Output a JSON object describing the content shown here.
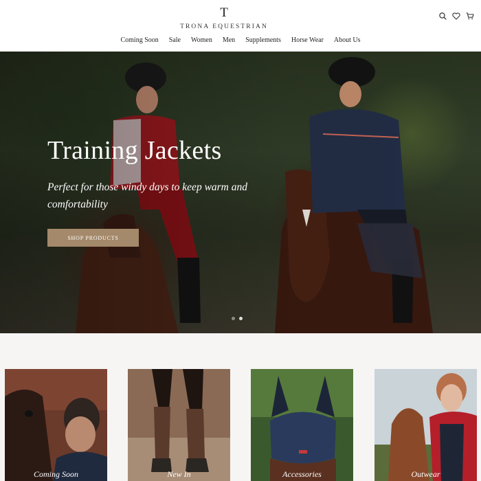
{
  "brand": {
    "mark": "T",
    "name": "TRONA EQUESTRIAN"
  },
  "header": {
    "icons": [
      "search-icon",
      "heart-icon",
      "cart-icon"
    ]
  },
  "nav": {
    "items": [
      "Coming Soon",
      "Sale",
      "Women",
      "Men",
      "Supplements",
      "Horse Wear",
      "About Us"
    ]
  },
  "hero": {
    "title": "Training Jackets",
    "subtitle": "Perfect for those windy days to keep warm and comfortability",
    "cta_label": "SHOP PRODUCTS",
    "slide_count": 2,
    "active_slide": 2
  },
  "categories": [
    {
      "label": "Coming Soon"
    },
    {
      "label": "New In"
    },
    {
      "label": "Accessories"
    },
    {
      "label": "Outwear"
    }
  ],
  "colors": {
    "cta": "#a4896a",
    "category_bg": "#f6f5f4"
  }
}
